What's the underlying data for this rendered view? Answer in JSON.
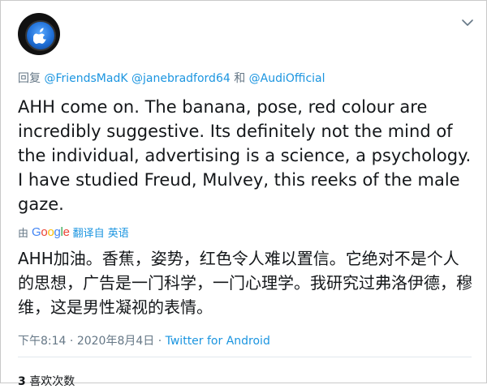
{
  "reply": {
    "prefix": "回复",
    "mentions": [
      "@FriendsMadK",
      "@janebradford64"
    ],
    "conjunction": "和",
    "last_mention": "@AudiOfficial"
  },
  "tweet": {
    "text": "AHH come on. The banana, pose, red colour are incredibly suggestive. Its definitely not the mind of the individual, advertising is a science, a psychology. I have studied Freud, Mulvey, this reeks of the male gaze."
  },
  "translation": {
    "by": "由",
    "provider": "Google",
    "link": "翻译自 英语",
    "text": "AHH加油。香蕉，姿势，红色令人难以置信。它绝对不是个人的思想，广告是一门科学，一门心理学。我研究过弗洛伊德，穆维，这是男性凝视的表情。"
  },
  "meta": {
    "time": "下午8:14",
    "separator1": " · ",
    "date": "2020年8月4日",
    "separator2": " · ",
    "source": "Twitter for Android"
  },
  "stats": {
    "likes_count": "3",
    "likes_label": "喜欢次数"
  },
  "colors": {
    "accent": "#1b95e0",
    "muted": "#657786",
    "text": "#14171a"
  },
  "icons": {
    "avatar": "apple-logo-icon",
    "menu": "chevron-down-icon"
  }
}
